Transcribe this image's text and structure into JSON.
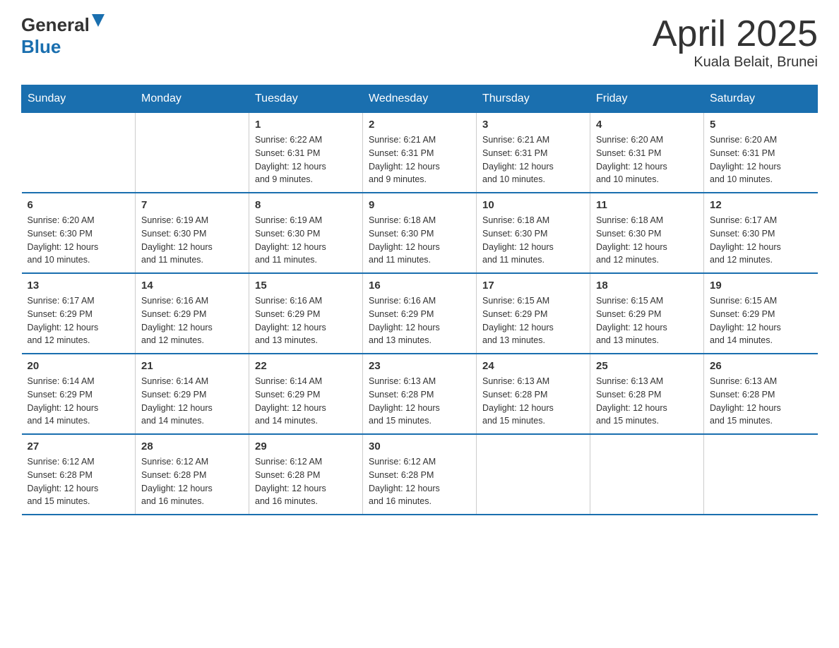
{
  "header": {
    "logo_general": "General",
    "logo_blue": "Blue",
    "title": "April 2025",
    "subtitle": "Kuala Belait, Brunei"
  },
  "days_of_week": [
    "Sunday",
    "Monday",
    "Tuesday",
    "Wednesday",
    "Thursday",
    "Friday",
    "Saturday"
  ],
  "weeks": [
    [
      {
        "num": "",
        "info": ""
      },
      {
        "num": "",
        "info": ""
      },
      {
        "num": "1",
        "info": "Sunrise: 6:22 AM\nSunset: 6:31 PM\nDaylight: 12 hours\nand 9 minutes."
      },
      {
        "num": "2",
        "info": "Sunrise: 6:21 AM\nSunset: 6:31 PM\nDaylight: 12 hours\nand 9 minutes."
      },
      {
        "num": "3",
        "info": "Sunrise: 6:21 AM\nSunset: 6:31 PM\nDaylight: 12 hours\nand 10 minutes."
      },
      {
        "num": "4",
        "info": "Sunrise: 6:20 AM\nSunset: 6:31 PM\nDaylight: 12 hours\nand 10 minutes."
      },
      {
        "num": "5",
        "info": "Sunrise: 6:20 AM\nSunset: 6:31 PM\nDaylight: 12 hours\nand 10 minutes."
      }
    ],
    [
      {
        "num": "6",
        "info": "Sunrise: 6:20 AM\nSunset: 6:30 PM\nDaylight: 12 hours\nand 10 minutes."
      },
      {
        "num": "7",
        "info": "Sunrise: 6:19 AM\nSunset: 6:30 PM\nDaylight: 12 hours\nand 11 minutes."
      },
      {
        "num": "8",
        "info": "Sunrise: 6:19 AM\nSunset: 6:30 PM\nDaylight: 12 hours\nand 11 minutes."
      },
      {
        "num": "9",
        "info": "Sunrise: 6:18 AM\nSunset: 6:30 PM\nDaylight: 12 hours\nand 11 minutes."
      },
      {
        "num": "10",
        "info": "Sunrise: 6:18 AM\nSunset: 6:30 PM\nDaylight: 12 hours\nand 11 minutes."
      },
      {
        "num": "11",
        "info": "Sunrise: 6:18 AM\nSunset: 6:30 PM\nDaylight: 12 hours\nand 12 minutes."
      },
      {
        "num": "12",
        "info": "Sunrise: 6:17 AM\nSunset: 6:30 PM\nDaylight: 12 hours\nand 12 minutes."
      }
    ],
    [
      {
        "num": "13",
        "info": "Sunrise: 6:17 AM\nSunset: 6:29 PM\nDaylight: 12 hours\nand 12 minutes."
      },
      {
        "num": "14",
        "info": "Sunrise: 6:16 AM\nSunset: 6:29 PM\nDaylight: 12 hours\nand 12 minutes."
      },
      {
        "num": "15",
        "info": "Sunrise: 6:16 AM\nSunset: 6:29 PM\nDaylight: 12 hours\nand 13 minutes."
      },
      {
        "num": "16",
        "info": "Sunrise: 6:16 AM\nSunset: 6:29 PM\nDaylight: 12 hours\nand 13 minutes."
      },
      {
        "num": "17",
        "info": "Sunrise: 6:15 AM\nSunset: 6:29 PM\nDaylight: 12 hours\nand 13 minutes."
      },
      {
        "num": "18",
        "info": "Sunrise: 6:15 AM\nSunset: 6:29 PM\nDaylight: 12 hours\nand 13 minutes."
      },
      {
        "num": "19",
        "info": "Sunrise: 6:15 AM\nSunset: 6:29 PM\nDaylight: 12 hours\nand 14 minutes."
      }
    ],
    [
      {
        "num": "20",
        "info": "Sunrise: 6:14 AM\nSunset: 6:29 PM\nDaylight: 12 hours\nand 14 minutes."
      },
      {
        "num": "21",
        "info": "Sunrise: 6:14 AM\nSunset: 6:29 PM\nDaylight: 12 hours\nand 14 minutes."
      },
      {
        "num": "22",
        "info": "Sunrise: 6:14 AM\nSunset: 6:29 PM\nDaylight: 12 hours\nand 14 minutes."
      },
      {
        "num": "23",
        "info": "Sunrise: 6:13 AM\nSunset: 6:28 PM\nDaylight: 12 hours\nand 15 minutes."
      },
      {
        "num": "24",
        "info": "Sunrise: 6:13 AM\nSunset: 6:28 PM\nDaylight: 12 hours\nand 15 minutes."
      },
      {
        "num": "25",
        "info": "Sunrise: 6:13 AM\nSunset: 6:28 PM\nDaylight: 12 hours\nand 15 minutes."
      },
      {
        "num": "26",
        "info": "Sunrise: 6:13 AM\nSunset: 6:28 PM\nDaylight: 12 hours\nand 15 minutes."
      }
    ],
    [
      {
        "num": "27",
        "info": "Sunrise: 6:12 AM\nSunset: 6:28 PM\nDaylight: 12 hours\nand 15 minutes."
      },
      {
        "num": "28",
        "info": "Sunrise: 6:12 AM\nSunset: 6:28 PM\nDaylight: 12 hours\nand 16 minutes."
      },
      {
        "num": "29",
        "info": "Sunrise: 6:12 AM\nSunset: 6:28 PM\nDaylight: 12 hours\nand 16 minutes."
      },
      {
        "num": "30",
        "info": "Sunrise: 6:12 AM\nSunset: 6:28 PM\nDaylight: 12 hours\nand 16 minutes."
      },
      {
        "num": "",
        "info": ""
      },
      {
        "num": "",
        "info": ""
      },
      {
        "num": "",
        "info": ""
      }
    ]
  ]
}
